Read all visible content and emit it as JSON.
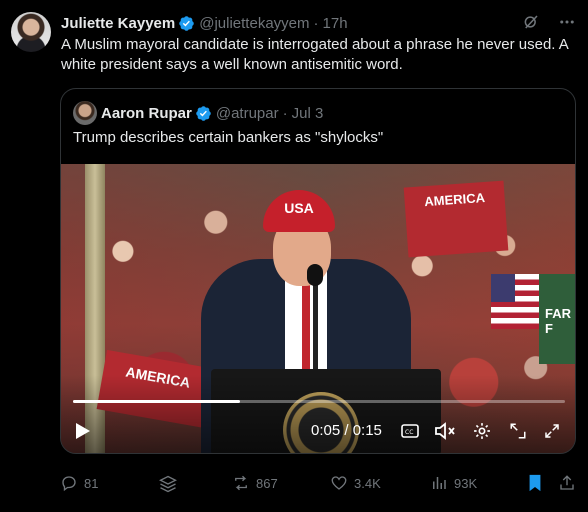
{
  "author": {
    "name": "Juliette Kayyem",
    "handle": "@juliettekayyem",
    "separator": "·",
    "time": "17h"
  },
  "tweet_text": "A Muslim mayoral candidate is interrogated about a phrase he never used. A white president says a well known antisemitic word.",
  "quoted": {
    "name": "Aaron Rupar",
    "handle": "@atrupar",
    "separator": "·",
    "time": "Jul 3",
    "text": "Trump describes certain bankers as \"shylocks\""
  },
  "video": {
    "scene_text": {
      "hat": "USA",
      "sign_top": "AMERICA",
      "sign_left": "AMERICA",
      "sign_right": "FAR F"
    },
    "time_display": "0:05 / 0:15",
    "progress_fraction": 0.34
  },
  "actions": {
    "replies": "81",
    "reposts": "867",
    "likes": "3.4K",
    "views": "93K"
  },
  "colors": {
    "background": "#000000",
    "text": "#e7e9ea",
    "muted": "#71767b",
    "verified": "#1d9bf0",
    "bookmark_active": "#1d9bf0"
  },
  "icons": [
    "verified-badge-icon",
    "grok-icon",
    "more-icon",
    "play-icon",
    "captions-icon",
    "mute-icon",
    "settings-icon",
    "pip-icon",
    "fullscreen-icon",
    "reply-icon",
    "stack-icon",
    "repost-icon",
    "like-icon",
    "views-icon",
    "bookmark-icon",
    "share-icon"
  ]
}
